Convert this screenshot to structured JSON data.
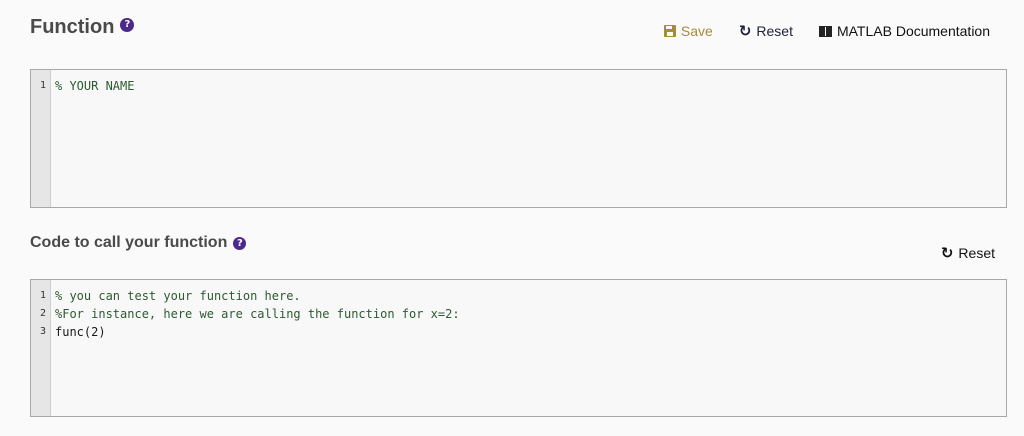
{
  "function_section": {
    "title": "Function",
    "help_glyph": "?",
    "toolbar": {
      "save_label": "Save",
      "reset_label": "Reset",
      "docs_label": "MATLAB Documentation"
    },
    "editor": {
      "line_numbers": [
        "1"
      ],
      "lines": [
        "% YOUR NAME"
      ]
    }
  },
  "call_section": {
    "title": "Code to call your function",
    "help_glyph": "?",
    "reset_label": "Reset",
    "editor": {
      "line_numbers": [
        "1",
        "2",
        "3"
      ],
      "lines": [
        "% you can test your function here.",
        "%For instance, here we are calling the function for x=2:",
        "func(2)"
      ]
    }
  },
  "icons": {
    "save": "save-icon",
    "reset": "reset-icon",
    "docs": "book-icon",
    "help": "help-icon"
  },
  "colors": {
    "accent_purple": "#4b2a8a",
    "save_gold": "#a88b3a",
    "comment_green": "#2d5a30"
  }
}
